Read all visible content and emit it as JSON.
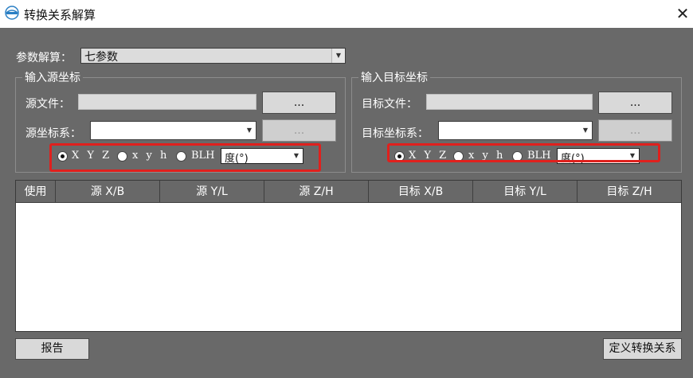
{
  "window": {
    "title": "转换关系解算",
    "close_glyph": "✕"
  },
  "solver": {
    "label": "参数解算：",
    "value": "七参数"
  },
  "source": {
    "group_title": "输入源坐标",
    "file_label": "源文件：",
    "system_label": "源坐标系：",
    "browse_label": "...",
    "browse2_label": "...",
    "radios": [
      "X Y Z",
      "x y h",
      "BLH"
    ],
    "selected_radio": 0,
    "unit_value": "度(°)"
  },
  "target": {
    "group_title": "输入目标坐标",
    "file_label": "目标文件：",
    "system_label": "目标坐标系：",
    "browse_label": "...",
    "browse2_label": "...",
    "radios": [
      "X Y Z",
      "x y h",
      "BLH"
    ],
    "selected_radio": 0,
    "unit_value": "度(°)"
  },
  "table": {
    "columns": [
      "使用",
      "源 X/B",
      "源 Y/L",
      "源 Z/H",
      "目标 X/B",
      "目标 Y/L",
      "目标 Z/H"
    ]
  },
  "buttons": {
    "report": "报告",
    "define": "定义转换关系"
  },
  "colors": {
    "highlight": "#e0201d",
    "panel": "#696969"
  }
}
